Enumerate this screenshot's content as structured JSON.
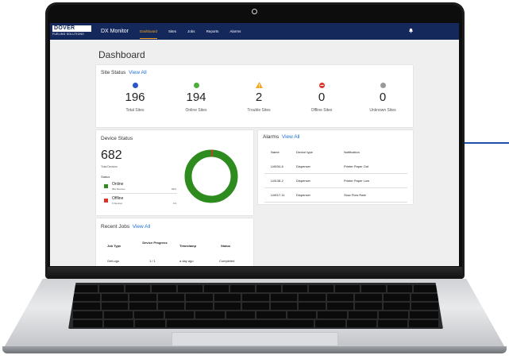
{
  "nav": {
    "logo_text": "DOVER",
    "logo_sub": "FUELING SOLUTIONS",
    "app_name": "DX Monitor",
    "items": [
      {
        "label": "Dashboard",
        "active": true
      },
      {
        "label": "Sites",
        "active": false
      },
      {
        "label": "Jobs",
        "active": false
      },
      {
        "label": "Reports",
        "active": false
      },
      {
        "label": "Alarms",
        "active": false
      }
    ],
    "notification_icon": "bell-icon"
  },
  "page": {
    "title": "Dashboard"
  },
  "site_status": {
    "title": "Site Status",
    "view_all": "View All",
    "stats": [
      {
        "value": "196",
        "label": "Total Sites",
        "color": "#2a56c6",
        "icon": "circle-blue-icon"
      },
      {
        "value": "194",
        "label": "Online Sites",
        "color": "#4caf3a",
        "icon": "circle-green-icon"
      },
      {
        "value": "2",
        "label": "Trouble Sites",
        "color": "#f5a623",
        "icon": "warning-triangle-icon"
      },
      {
        "value": "0",
        "label": "Offline Sites",
        "color": "#d9342b",
        "icon": "minus-circle-red-icon"
      },
      {
        "value": "0",
        "label": "Unknown Sites",
        "color": "#9a9a9a",
        "icon": "circle-gray-icon"
      }
    ]
  },
  "device_status": {
    "title": "Device Status",
    "total": "682",
    "total_label": "Total Devices",
    "status_label": "Status",
    "legend": [
      {
        "name": "Online",
        "sub": "681 Devices",
        "pct": "99%",
        "color": "#2e8b1e",
        "value": 681
      },
      {
        "name": "Offline",
        "sub": "1 Devices",
        "pct": "1%",
        "color": "#d9342b",
        "value": 1
      }
    ]
  },
  "alarms": {
    "title": "Alarms",
    "view_all": "View All",
    "headers": [
      "Name",
      "Device type",
      "Notification"
    ],
    "rows": [
      [
        "LM034-6",
        "Dispenser",
        "Printer Paper Out"
      ],
      [
        "LM138-2",
        "Dispenser",
        "Printer Paper Low"
      ],
      [
        "LM017-11",
        "Dispenser",
        "Slow Flow Rate"
      ]
    ]
  },
  "recent_jobs": {
    "title": "Recent Jobs",
    "view_all": "View All",
    "headers": [
      "Job Type",
      "Device Progress",
      "Timestamp",
      "Status"
    ],
    "rows": [
      [
        "GetLogs",
        "1 / 1",
        "a day ago",
        "Completed"
      ]
    ]
  },
  "colors": {
    "navbar": "#15285c",
    "accent": "#f5a623",
    "link": "#1f6fd8"
  }
}
